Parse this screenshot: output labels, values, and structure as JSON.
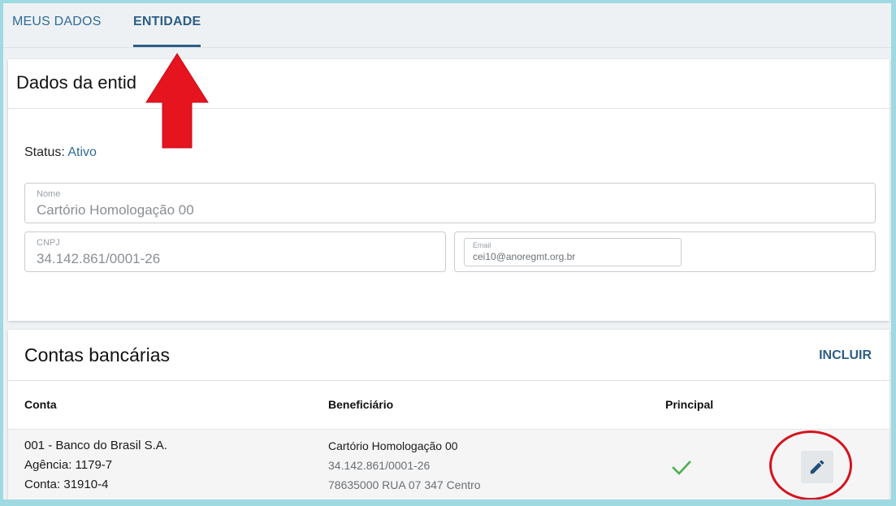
{
  "tabs": [
    {
      "label": "MEUS DADOS"
    },
    {
      "label": "ENTIDADE",
      "active": true
    }
  ],
  "entity": {
    "title": "Dados da entid",
    "status_label": "Status:",
    "status_value": "Ativo",
    "nome_label": "Nome",
    "nome_value": "Cartório Homologação 00",
    "cnpj_label": "CNPJ",
    "cnpj_value": "34.142.861/0001-26",
    "email_label": "Email",
    "email_value": "cei10@anoregmt.org.br"
  },
  "bank": {
    "title": "Contas bancárias",
    "add_label": "INCLUIR",
    "headers": {
      "conta": "Conta",
      "beneficiario": "Beneficiário",
      "principal": "Principal"
    },
    "rows": [
      {
        "banco": "001 - Banco do Brasil S.A.",
        "agencia": "Agência: 1179-7",
        "conta": "Conta: 31910-4",
        "beneficiario_nome": "Cartório Homologação 00",
        "beneficiario_cnpj": "34.142.861/0001-26",
        "beneficiario_endereco": "78635000 RUA 07 347 Centro",
        "principal": true
      }
    ]
  },
  "icons": {
    "check": "check-icon",
    "edit": "pencil-icon",
    "annotation_arrow": "red-up-arrow",
    "annotation_circle": "red-circle"
  },
  "colors": {
    "accent": "#2d5e86",
    "link": "#2f6b98",
    "check": "#4caf50",
    "annotation": "#e5141f"
  }
}
